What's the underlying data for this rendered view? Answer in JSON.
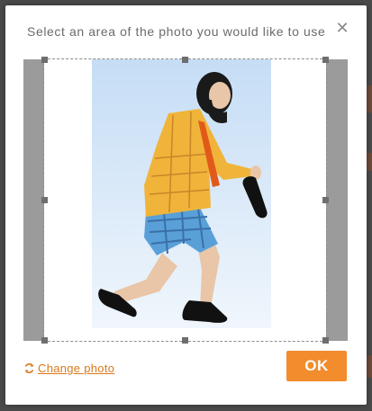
{
  "dialog": {
    "title": "Select an area of the photo you would like to use",
    "close_icon": "close-icon",
    "change_photo_label": "Change photo",
    "change_photo_icon": "refresh-icon",
    "ok_label": "OK"
  },
  "colors": {
    "accent": "#f28c2d",
    "link": "#d9791a",
    "cropper_bg": "#9b9b9b"
  }
}
